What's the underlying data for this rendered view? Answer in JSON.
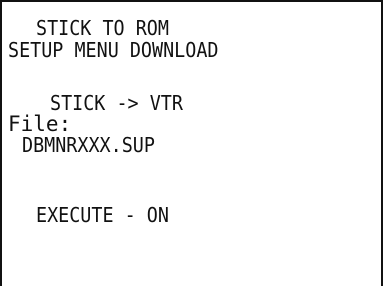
{
  "screen": {
    "title_line_1": "STICK TO ROM",
    "title_line_2": "SETUP MENU DOWNLOAD",
    "direction": "STICK -> VTR",
    "file_label": "File:",
    "file_name": "DBMNRXXX.SUP",
    "execute_status": "EXECUTE - ON"
  }
}
